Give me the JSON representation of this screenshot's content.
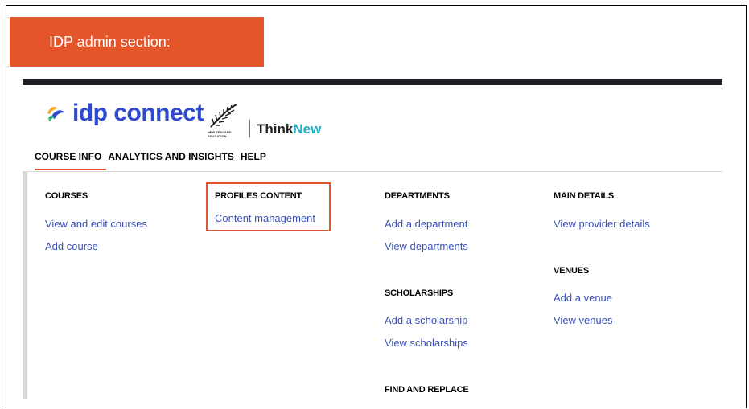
{
  "callout": {
    "label": "IDP admin section:"
  },
  "brand": {
    "logo_text": "idp connect",
    "nz_caption": "NEW ZEALAND EDUCATION",
    "think": "Think",
    "new": "New"
  },
  "nav": {
    "tabs": [
      "COURSE INFO",
      "ANALYTICS AND INSIGHTS",
      "HELP"
    ]
  },
  "menu": {
    "courses": {
      "heading": "COURSES",
      "links": [
        "View and edit courses",
        "Add course"
      ]
    },
    "profiles": {
      "heading": "PROFILES CONTENT",
      "links": [
        "Content management"
      ]
    },
    "departments": {
      "heading": "DEPARTMENTS",
      "links": [
        "Add a department",
        "View departments"
      ]
    },
    "scholarships": {
      "heading": "SCHOLARSHIPS",
      "links": [
        "Add a scholarship",
        "View scholarships"
      ]
    },
    "find_replace": {
      "heading": "FIND AND REPLACE"
    },
    "main_details": {
      "heading": "MAIN DETAILS",
      "links": [
        "View provider details"
      ]
    },
    "venues": {
      "heading": "VENUES",
      "links": [
        "Add a venue",
        "View venues"
      ]
    }
  },
  "colors": {
    "accent": "#e5552b",
    "link": "#3a51b8",
    "brand_blue": "#2d4ad1",
    "brand_teal": "#1fb1c3"
  }
}
